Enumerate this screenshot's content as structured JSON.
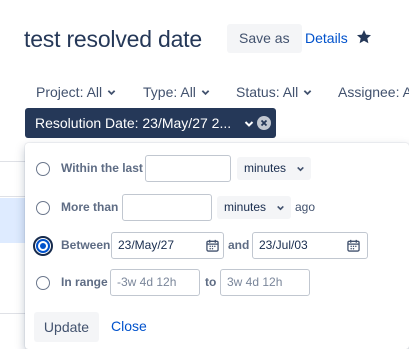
{
  "header": {
    "title": "test resolved date",
    "save_as": "Save as",
    "details": "Details",
    "star_icon": "star-icon"
  },
  "filters": {
    "project": "Project: All",
    "type": "Type: All",
    "status": "Status: All",
    "assignee": "Assignee: A"
  },
  "resolution_chip": {
    "label": "Resolution Date: 23/May/27 2...",
    "clear_icon": "clear-icon"
  },
  "date_panel": {
    "within": {
      "label": "Within the last",
      "value": "",
      "unit": "minutes",
      "checked": false
    },
    "more_than": {
      "label": "More than",
      "value": "",
      "unit": "minutes",
      "suffix": "ago",
      "checked": false
    },
    "between": {
      "label": "Between",
      "from": "23/May/27",
      "joiner": "and",
      "to": "23/Jul/03",
      "checked": true
    },
    "in_range": {
      "label": "In range",
      "from_placeholder": "-3w 4d 12h",
      "joiner": "to",
      "to_placeholder": "3w 4d 12h",
      "checked": false
    },
    "update": "Update",
    "close": "Close"
  },
  "colors": {
    "chip_bg": "#253858",
    "link": "#0052cc",
    "radio_selected": "#0052cc"
  }
}
